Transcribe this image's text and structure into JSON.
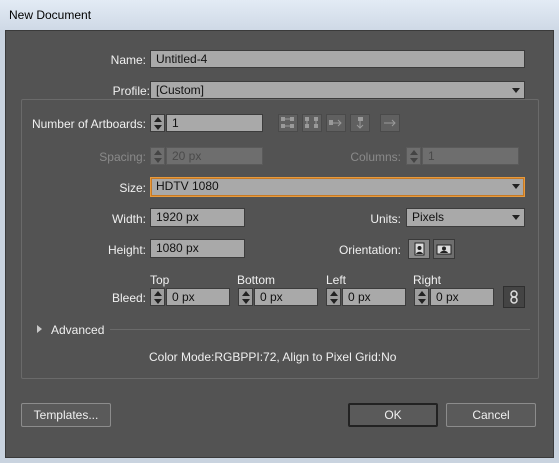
{
  "window": {
    "title": "New Document"
  },
  "form": {
    "name": {
      "label": "Name:",
      "value": "Untitled-4"
    },
    "profile": {
      "label": "Profile:",
      "value": "[Custom]"
    },
    "artboards": {
      "label": "Number of Artboards:",
      "value": "1"
    },
    "spacing": {
      "label": "Spacing:",
      "value": "20 px"
    },
    "columns": {
      "label": "Columns:",
      "value": "1"
    },
    "size": {
      "label": "Size:",
      "value": "HDTV 1080"
    },
    "width": {
      "label": "Width:",
      "value": "1920 px"
    },
    "units": {
      "label": "Units:",
      "value": "Pixels"
    },
    "height": {
      "label": "Height:",
      "value": "1080 px"
    },
    "orientation": {
      "label": "Orientation:"
    },
    "bleed": {
      "label": "Bleed:",
      "top": {
        "label": "Top",
        "value": "0 px"
      },
      "bottom": {
        "label": "Bottom",
        "value": "0 px"
      },
      "left": {
        "label": "Left",
        "value": "0 px"
      },
      "right": {
        "label": "Right",
        "value": "0 px"
      }
    },
    "advanced": {
      "label": "Advanced"
    },
    "info": "Color Mode:RGBPPI:72, Align to Pixel Grid:No"
  },
  "buttons": {
    "templates": "Templates...",
    "ok": "OK",
    "cancel": "Cancel"
  },
  "icons": [
    "grid-by-row-icon",
    "grid-by-column-icon",
    "arrange-by-row-icon",
    "arrange-by-column-icon",
    "right-to-left-icon",
    "portrait-icon",
    "landscape-icon",
    "link-icon",
    "expand-triangle-icon",
    "spinner-icon",
    "dropdown-arrow-icon"
  ],
  "colors": {
    "dialog_bg": "#535353",
    "focus_ring": "#e89a3c",
    "field_bg": "#a9a9a9"
  }
}
